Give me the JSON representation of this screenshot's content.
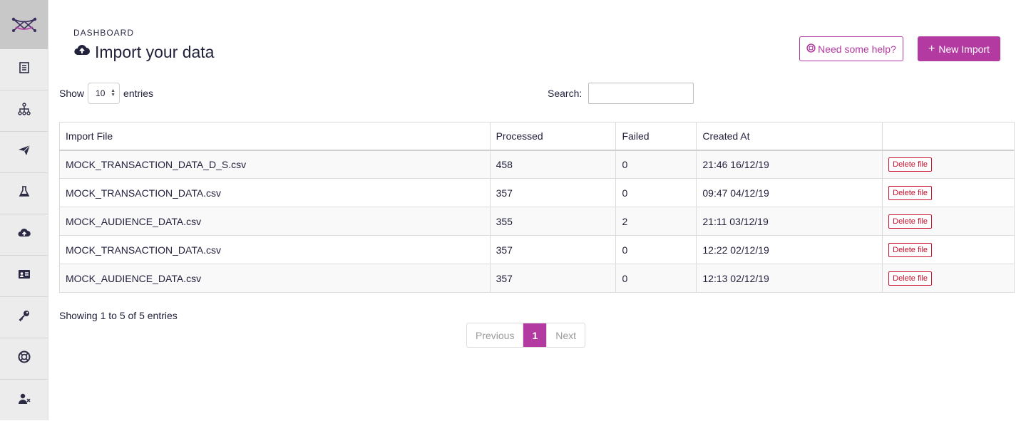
{
  "sidebar": {
    "logo_icon": "network-logo-icon",
    "items": [
      {
        "name": "sidebar-item-reports",
        "icon": "document-list-icon"
      },
      {
        "name": "sidebar-item-hierarchy",
        "icon": "hierarchy-icon"
      },
      {
        "name": "sidebar-item-campaigns",
        "icon": "paper-plane-icon"
      },
      {
        "name": "sidebar-item-experiments",
        "icon": "flask-icon"
      },
      {
        "name": "sidebar-item-import",
        "icon": "cloud-upload-icon"
      },
      {
        "name": "sidebar-item-contacts",
        "icon": "id-card-icon"
      },
      {
        "name": "sidebar-item-keys",
        "icon": "key-icon"
      },
      {
        "name": "sidebar-item-help",
        "icon": "lifebuoy-icon"
      },
      {
        "name": "sidebar-item-delete-user",
        "icon": "user-times-icon"
      }
    ]
  },
  "header": {
    "breadcrumb": "DASHBOARD",
    "title": "Import your data",
    "help_label": "Need some help?",
    "new_import_label": "New Import"
  },
  "controls": {
    "show_label": "Show",
    "entries_label": "entries",
    "page_length": "10",
    "search_label": "Search:",
    "search_value": ""
  },
  "table": {
    "columns": [
      "Import File",
      "Processed",
      "Failed",
      "Created At",
      ""
    ],
    "rows": [
      {
        "file": "MOCK_TRANSACTION_DATA_D_S.csv",
        "processed": "458",
        "failed": "0",
        "created": "21:46 16/12/19",
        "action": "Delete file"
      },
      {
        "file": "MOCK_TRANSACTION_DATA.csv",
        "processed": "357",
        "failed": "0",
        "created": "09:47 04/12/19",
        "action": "Delete file"
      },
      {
        "file": "MOCK_AUDIENCE_DATA.csv",
        "processed": "355",
        "failed": "2",
        "created": "21:11 03/12/19",
        "action": "Delete file"
      },
      {
        "file": "MOCK_TRANSACTION_DATA.csv",
        "processed": "357",
        "failed": "0",
        "created": "12:22 02/12/19",
        "action": "Delete file"
      },
      {
        "file": "MOCK_AUDIENCE_DATA.csv",
        "processed": "357",
        "failed": "0",
        "created": "12:13 02/12/19",
        "action": "Delete file"
      }
    ]
  },
  "footer": {
    "info": "Showing 1 to 5 of 5 entries",
    "prev_label": "Previous",
    "current_page": "1",
    "next_label": "Next"
  },
  "colors": {
    "accent": "#b23aa0",
    "danger": "#c8102e",
    "sidebar_bg": "#ececec"
  }
}
